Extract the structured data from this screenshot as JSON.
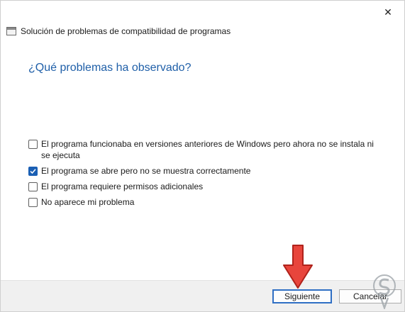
{
  "window": {
    "close_glyph": "✕"
  },
  "wizard": {
    "title": "Solución de problemas de compatibilidad de programas",
    "question": "¿Qué problemas ha observado?"
  },
  "options": [
    {
      "label": "El programa funcionaba en versiones anteriores de Windows pero ahora no se instala ni se ejecuta",
      "checked": false
    },
    {
      "label": "El programa se abre pero no se muestra correctamente",
      "checked": true
    },
    {
      "label": "El programa requiere permisos adicionales",
      "checked": false
    },
    {
      "label": "No aparece mi problema",
      "checked": false
    }
  ],
  "footer": {
    "next_label": "Siguiente",
    "cancel_label": "Cancelar"
  },
  "colors": {
    "accent": "#1a5fb4",
    "question_text": "#1f5fa8",
    "arrow": "#e8453c"
  },
  "icons": {
    "close": "close-icon",
    "app": "compatibility-troubleshooter-icon",
    "pointer": "red-pointer-arrow",
    "logo": "solvetic-watermark"
  }
}
